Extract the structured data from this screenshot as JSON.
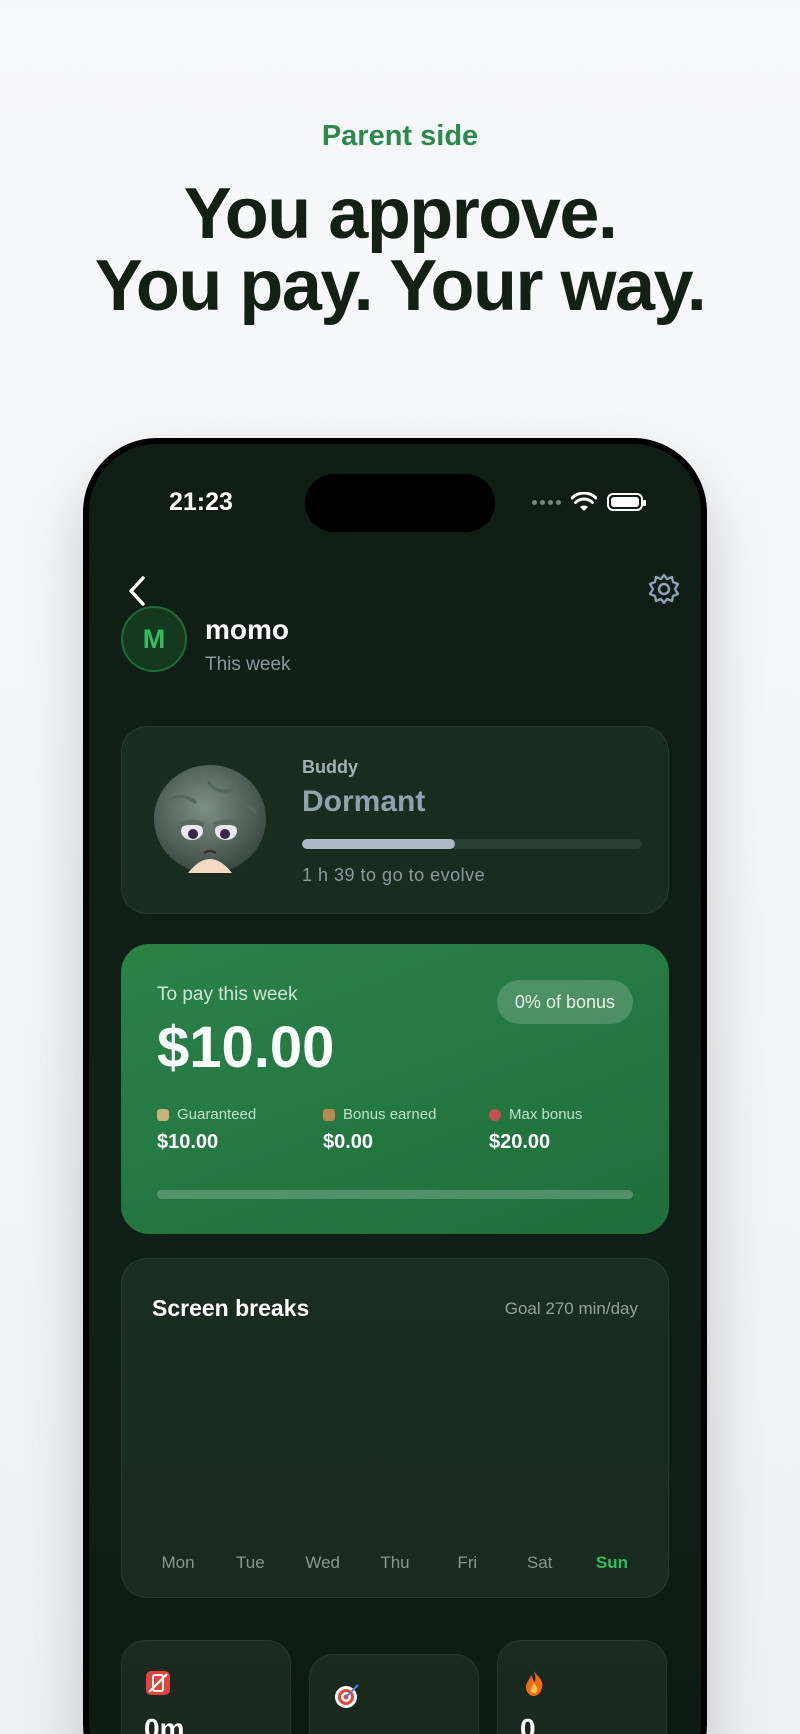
{
  "hero": {
    "eyebrow": "Parent side",
    "title_line1": "You approve.",
    "title_line2": "You pay. Your way."
  },
  "status_bar": {
    "time": "21:23",
    "icons": [
      "signal-dots-icon",
      "wifi-icon",
      "battery-icon"
    ]
  },
  "nav": {
    "back_icon": "chevron-left-icon",
    "settings_icon": "gear-icon"
  },
  "profile": {
    "initial": "M",
    "name": "momo",
    "period": "This week",
    "accent": "#2fbf5e"
  },
  "buddy": {
    "label": "Buddy",
    "state": "Dormant",
    "progress": 0.45,
    "note": "1 h 39 to go to evolve"
  },
  "payment": {
    "label": "To pay this week",
    "amount": "$10.00",
    "bonus_pill": "0% of bonus",
    "progress": 0,
    "stats": [
      {
        "label": "Guaranteed",
        "value": "$10.00",
        "icon": "shield-icon"
      },
      {
        "label": "Bonus earned",
        "value": "$0.00",
        "icon": "money-bag-icon"
      },
      {
        "label": "Max bonus",
        "value": "$20.00",
        "icon": "target-icon"
      }
    ],
    "card_color": "#2a8249"
  },
  "screen_breaks": {
    "title": "Screen breaks",
    "goal": "Goal 270 min/day",
    "days": [
      "Mon",
      "Tue",
      "Wed",
      "Thu",
      "Fri",
      "Sat",
      "Sun"
    ],
    "active_day": "Sun"
  },
  "mini_stats": [
    {
      "icon": "no-phone-icon",
      "value": "0m"
    },
    {
      "icon": "target-icon",
      "value": ""
    },
    {
      "icon": "fire-icon",
      "value": "0"
    }
  ]
}
